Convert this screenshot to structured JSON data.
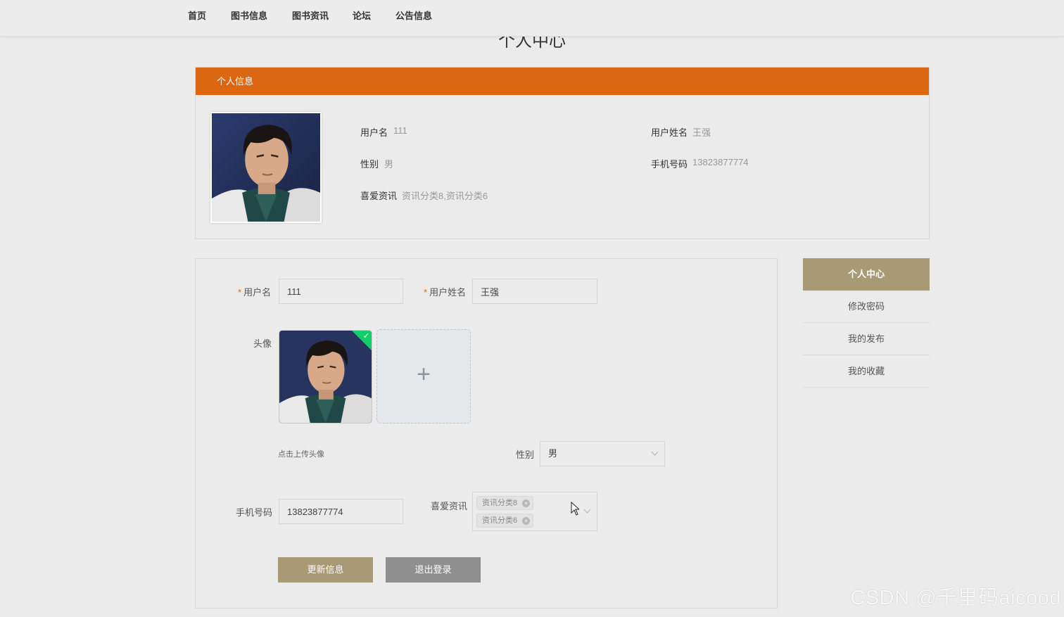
{
  "nav": {
    "items": [
      "首页",
      "图书信息",
      "图书资讯",
      "论坛",
      "公告信息"
    ]
  },
  "page_title": "个人中心",
  "info_card": {
    "header": "个人信息",
    "username_label": "用户名",
    "username_value": "111",
    "realname_label": "用户姓名",
    "realname_value": "王强",
    "gender_label": "性别",
    "gender_value": "男",
    "phone_label": "手机号码",
    "phone_value": "13823877774",
    "favorite_label": "喜爱资讯",
    "favorite_value": "资讯分类8,资讯分类6"
  },
  "form": {
    "username_label": "用户名",
    "username_value": "111",
    "realname_label": "用户姓名",
    "realname_value": "王强",
    "avatar_label": "头像",
    "upload_plus": "+",
    "upload_hint": "点击上传头像",
    "gender_label": "性别",
    "gender_value": "男",
    "phone_label": "手机号码",
    "phone_value": "13823877774",
    "favorite_label": "喜爱资讯",
    "favorite_tags": [
      "资讯分类8",
      "资讯分类6"
    ],
    "required_mark": "*",
    "update_button": "更新信息",
    "logout_button": "退出登录",
    "success_check": "✓",
    "tag_close": "×"
  },
  "side_menu": {
    "items": [
      "个人中心",
      "修改密码",
      "我的发布",
      "我的收藏"
    ]
  },
  "watermark": "CSDN @千里码aicood",
  "colors": {
    "header_orange": "#dc6713",
    "accent_tan": "#a89a75",
    "logout_gray": "#8f8f8f",
    "success_green": "#13ce66"
  }
}
